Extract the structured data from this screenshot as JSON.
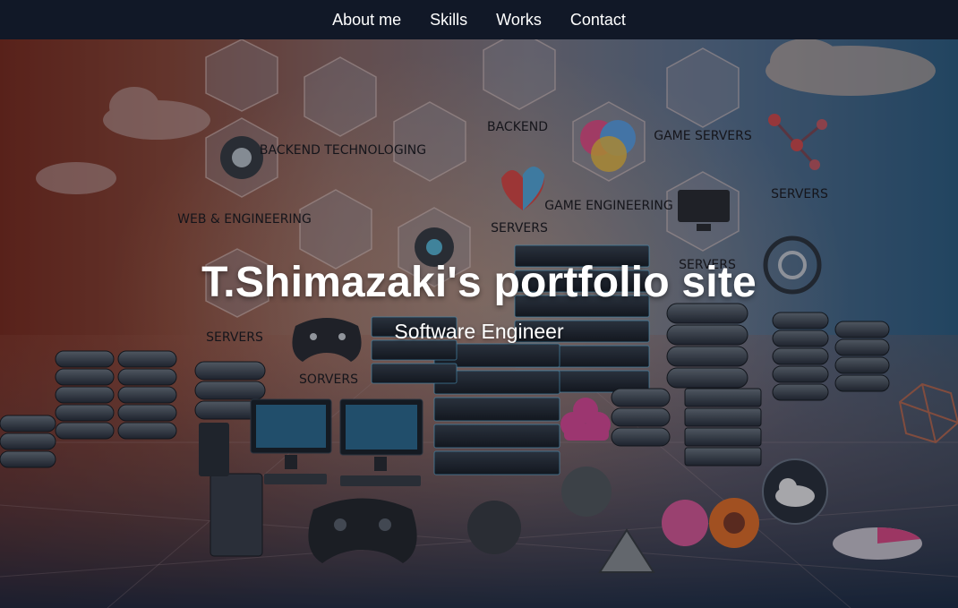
{
  "nav": {
    "items": [
      {
        "label": "About me"
      },
      {
        "label": "Skills"
      },
      {
        "label": "Works"
      },
      {
        "label": "Contact"
      }
    ]
  },
  "hero": {
    "title": "T.Shimazaki's portfolio site",
    "subtitle": "Software Engineer",
    "image_labels": {
      "backend_technologies": "BACKEND TECHNOLOGING",
      "backend": "BACKEND",
      "game_servers": "GAME SERVERS",
      "web_engineering": "WEB & ENGINEERING",
      "game_engineering": "GAME ENGINEERING",
      "servers": "SERVERS",
      "sorvers": "SORVERS"
    },
    "image_semantic": "backend-servers-illustration"
  }
}
